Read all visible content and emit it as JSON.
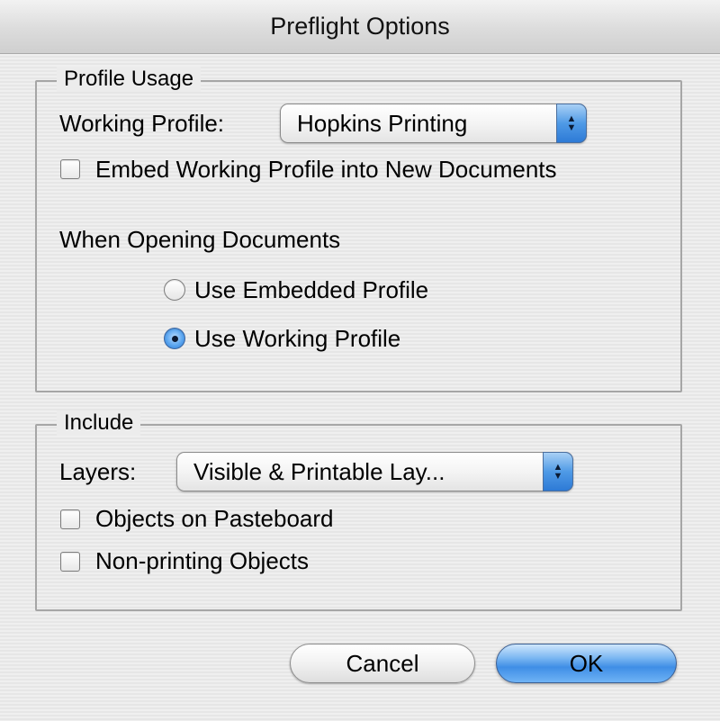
{
  "window": {
    "title": "Preflight Options"
  },
  "profile_usage": {
    "group_label": "Profile Usage",
    "working_profile_label": "Working Profile:",
    "working_profile_value": "Hopkins Printing",
    "embed_checkbox": {
      "label": "Embed Working Profile into New Documents",
      "checked": false
    },
    "when_opening_label": "When Opening Documents",
    "radios": [
      {
        "label": "Use Embedded Profile",
        "selected": false
      },
      {
        "label": "Use Working Profile",
        "selected": true
      }
    ]
  },
  "include": {
    "group_label": "Include",
    "layers_label": "Layers:",
    "layers_value": "Visible & Printable Lay...",
    "checkboxes": [
      {
        "label": "Objects on Pasteboard",
        "checked": false
      },
      {
        "label": "Non-printing Objects",
        "checked": false
      }
    ]
  },
  "buttons": {
    "cancel": "Cancel",
    "ok": "OK"
  },
  "colors": {
    "accent": "#3f8ee6",
    "group_border": "#a6a6a6",
    "background": "#ececec"
  }
}
